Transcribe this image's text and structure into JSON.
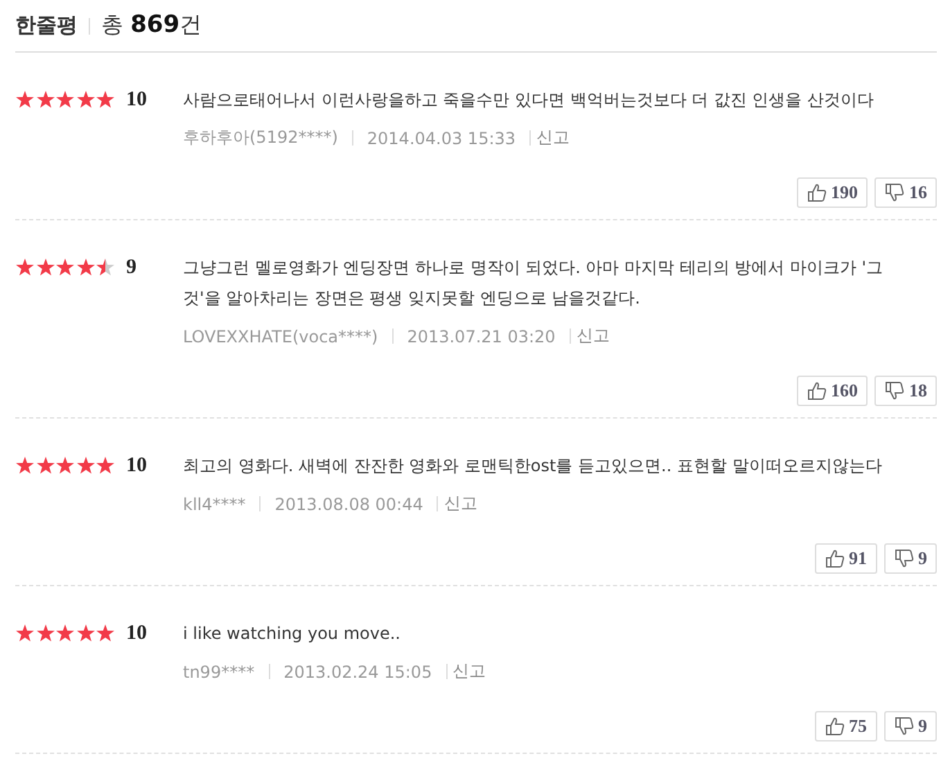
{
  "header": {
    "title": "한줄평",
    "total_prefix": "총",
    "total_count": "869",
    "total_suffix": "건"
  },
  "reviews": [
    {
      "stars": 5,
      "score": "10",
      "text": "사람으로태어나서 이런사랑을하고 죽을수만 있다면 백억버는것보다 더 값진 인생을 산것이다",
      "author": "후하후아(5192****)",
      "date": "2014.04.03 15:33",
      "report": "신고",
      "likes": "190",
      "dislikes": "16"
    },
    {
      "stars": 4.5,
      "score": "9",
      "text": "그냥그런 멜로영화가 엔딩장면 하나로 명작이 되었다. 아마 마지막 테리의 방에서 마이크가 '그것'을 알아차리는 장면은 평생 잊지못할 엔딩으로 남을것같다.",
      "author": "LOVEXXHATE(voca****)",
      "date": "2013.07.21 03:20",
      "report": "신고",
      "likes": "160",
      "dislikes": "18"
    },
    {
      "stars": 5,
      "score": "10",
      "text": "최고의 영화다. 새벽에 잔잔한 영화와 로맨틱한ost를 듣고있으면.. 표현할 말이떠오르지않는다",
      "author": "kll4****",
      "date": "2013.08.08 00:44",
      "report": "신고",
      "likes": "91",
      "dislikes": "9"
    },
    {
      "stars": 5,
      "score": "10",
      "text": "i like watching you move..",
      "author": "tn99****",
      "date": "2013.02.24 15:05",
      "report": "신고",
      "likes": "75",
      "dislikes": "9"
    }
  ]
}
